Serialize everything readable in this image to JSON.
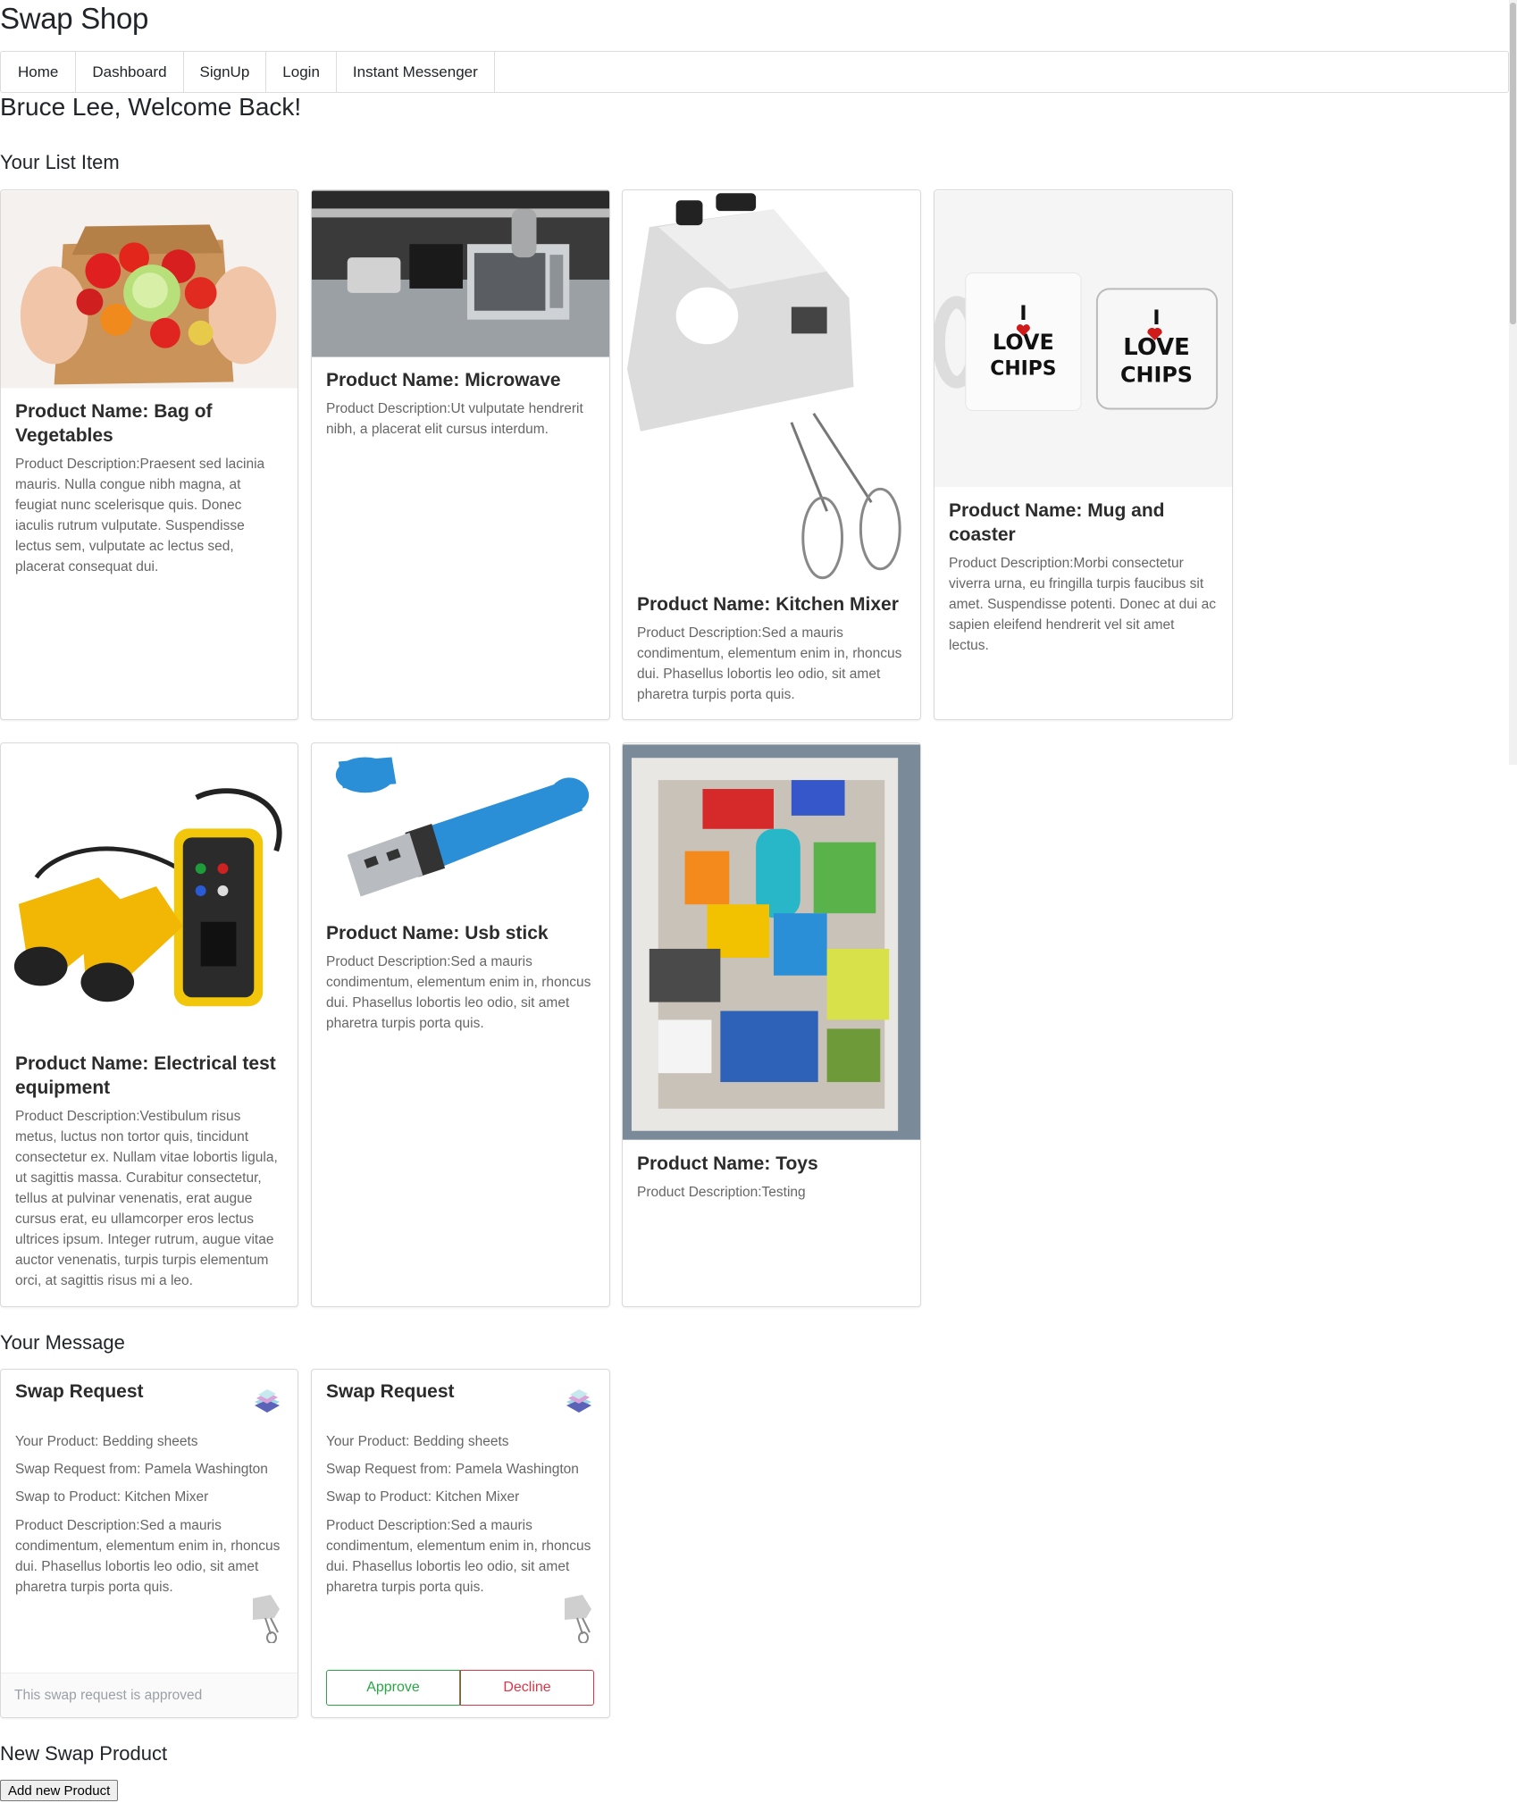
{
  "app_title": "Swap Shop",
  "nav": [
    {
      "label": "Home"
    },
    {
      "label": "Dashboard"
    },
    {
      "label": "SignUp"
    },
    {
      "label": "Login"
    },
    {
      "label": "Instant Messenger"
    }
  ],
  "welcome": "Bruce Lee, Welcome Back!",
  "list_heading": "Your List Item",
  "products": [
    {
      "title": "Product Name: Bag of Vegetables",
      "desc": "Product Description:Praesent sed lacinia mauris. Nulla congue nibh magna, at feugiat nunc scelerisque quis. Donec iaculis rutrum vulputate. Suspendisse lectus sem, vulputate ac lectus sed, placerat consequat dui.",
      "icon": "vegetables-bag-image"
    },
    {
      "title": "Product Name: Microwave",
      "desc": "Product Description:Ut vulputate hendrerit nibh, a placerat elit cursus interdum.",
      "icon": "microwave-image"
    },
    {
      "title": "Product Name: Kitchen Mixer",
      "desc": "Product Description:Sed a mauris condimentum, elementum enim in, rhoncus dui. Phasellus lobortis leo odio, sit amet pharetra turpis porta quis.",
      "icon": "kitchen-mixer-image"
    },
    {
      "title": "Product Name: Mug and coaster",
      "desc": "Product Description:Morbi consectetur viverra urna, eu fringilla turpis faucibus sit amet. Suspendisse potenti. Donec at dui ac sapien eleifend hendrerit vel sit amet lectus.",
      "icon": "mug-coaster-image",
      "mug_text_1": "I",
      "mug_text_2": "LOVE",
      "mug_text_3": "CHIPS"
    },
    {
      "title": "Product Name: Electrical test equipment",
      "desc": "Product Description:Vestibulum risus metus, luctus non tortor quis, tincidunt consectetur ex. Nullam vitae lobortis ligula, ut sagittis massa. Curabitur consectetur, tellus at pulvinar venenatis, erat augue cursus erat, eu ullamcorper eros lectus ultrices ipsum. Integer rutrum, augue vitae auctor venenatis, turpis turpis elementum orci, at sagittis risus mi a leo.",
      "icon": "electrical-tester-image"
    },
    {
      "title": "Product Name: Usb stick",
      "desc": "Product Description:Sed a mauris condimentum, elementum enim in, rhoncus dui. Phasellus lobortis leo odio, sit amet pharetra turpis porta quis.",
      "icon": "usb-stick-image"
    },
    {
      "title": "Product Name: Toys",
      "desc": "Product Description:Testing",
      "icon": "toys-bin-image"
    }
  ],
  "message_heading": "Your Message",
  "messages": [
    {
      "title": "Swap Request",
      "your_product": "Your Product: Bedding sheets",
      "from": "Swap Request from: Pamela Washington",
      "to": "Swap to Product: Kitchen Mixer",
      "desc": "Product Description:Sed a mauris condimentum, elementum enim in, rhoncus dui. Phasellus lobortis leo odio, sit amet pharetra turpis porta quis.",
      "status": "This swap request is approved"
    },
    {
      "title": "Swap Request",
      "your_product": "Your Product: Bedding sheets",
      "from": "Swap Request from: Pamela Washington",
      "to": "Swap to Product: Kitchen Mixer",
      "desc": "Product Description:Sed a mauris condimentum, elementum enim in, rhoncus dui. Phasellus lobortis leo odio, sit amet pharetra turpis porta quis.",
      "approve_label": "Approve",
      "decline_label": "Decline"
    }
  ],
  "new_heading": "New Swap Product",
  "add_button": "Add new Product",
  "colors": {
    "approve": "#28a745",
    "decline": "#dc3545",
    "usb_blue": "#2a8fd6",
    "tester_yellow": "#f2b705"
  }
}
